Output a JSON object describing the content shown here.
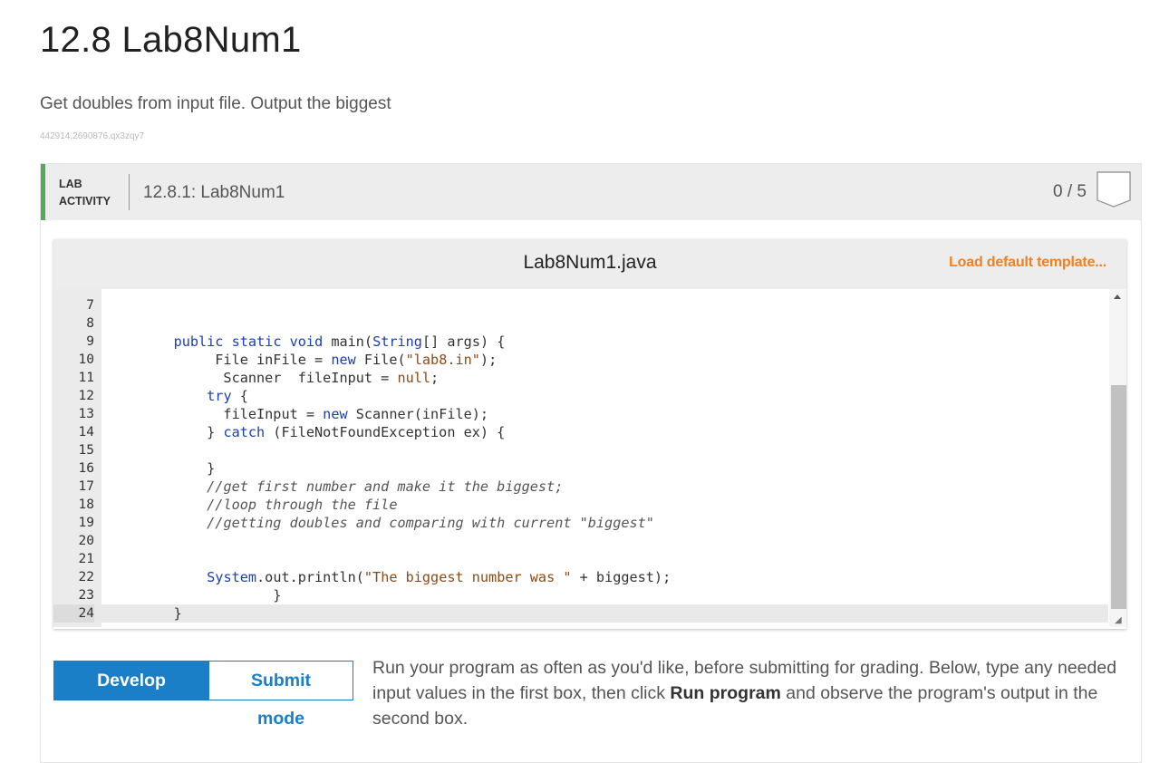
{
  "page": {
    "title": "12.8 Lab8Num1",
    "subtitle": "Get doubles from input file. Output the biggest",
    "section_id": "442914.2690876.qx3zqy7"
  },
  "lab": {
    "label_line1": "LAB",
    "label_line2": "ACTIVITY",
    "name": "12.8.1: Lab8Num1",
    "score": "0 / 5",
    "accent_color": "#5aa75a"
  },
  "editor": {
    "file_name": "Lab8Num1.java",
    "load_template_label": "Load default template...",
    "line_numbers": [
      "7",
      "8",
      "9",
      "10",
      "11",
      "12",
      "13",
      "14",
      "15",
      "16",
      "17",
      "18",
      "19",
      "20",
      "21",
      "22",
      "23",
      "24"
    ],
    "active_line": "24"
  },
  "modes": {
    "develop_label": "Develop mode",
    "submit_label": "Submit mode",
    "active": "Develop mode"
  },
  "instructions": {
    "part1": "Run your program as often as you'd like, before submitting for grading. Below, type any needed input values in the first box, then click ",
    "bold": "Run program",
    "part2": " and observe the program's output in the second box."
  },
  "colors": {
    "link_orange": "#f08020",
    "primary_blue": "#1a7fc7"
  }
}
